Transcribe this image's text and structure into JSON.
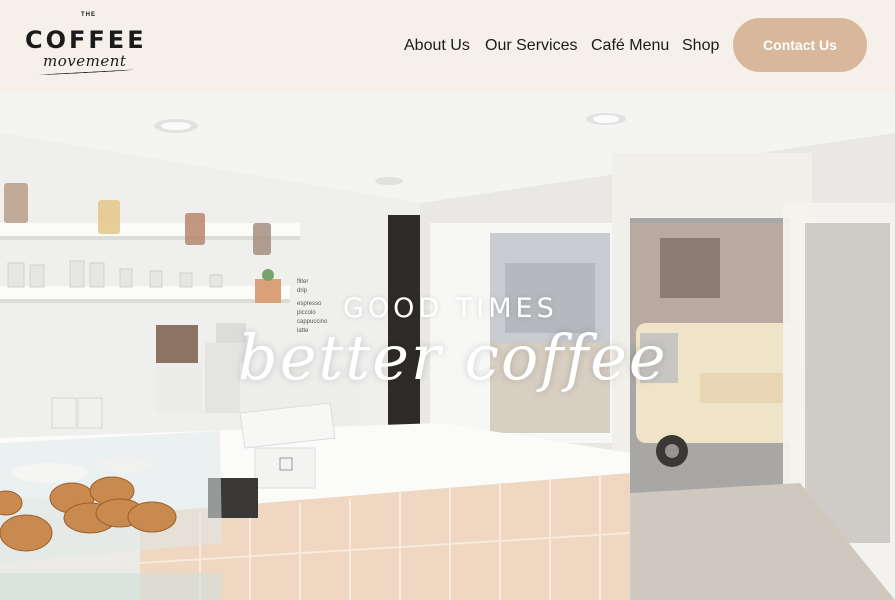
{
  "brand": {
    "the": "THE",
    "name": "COFFEE",
    "tagline": "movement"
  },
  "nav": {
    "items": [
      "About Us",
      "Our Services",
      "Café Menu",
      "Shop"
    ],
    "contact_label": "Contact Us"
  },
  "hero": {
    "line1": "GOOD TIMES",
    "line2": "better coffee",
    "menu_board": [
      "espresso",
      "piccolo",
      "cappuccino",
      "latte",
      "filter",
      "drip"
    ]
  },
  "colors": {
    "background": "#f5f1ea",
    "accent_button": "#d9b79a",
    "hero_text": "#ffffff"
  }
}
